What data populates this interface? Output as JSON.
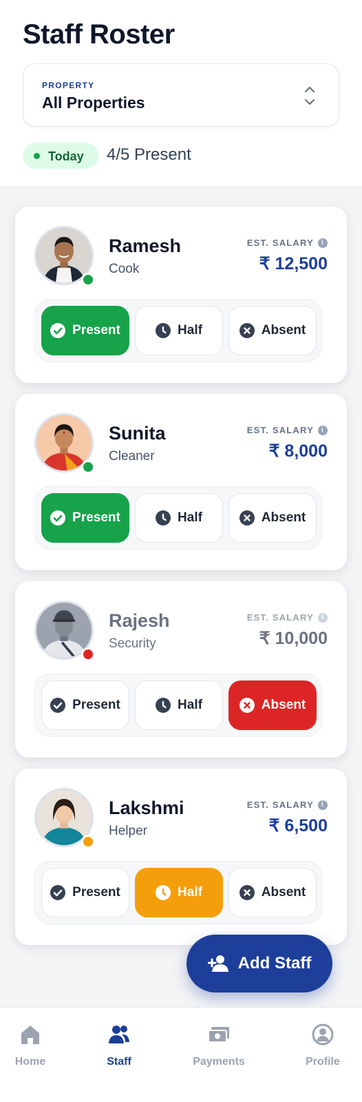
{
  "header": {
    "title": "Staff Roster",
    "property_label": "PROPERTY",
    "property_value": "All Properties",
    "today_label": "Today",
    "present_summary": "4/5 Present"
  },
  "staff": [
    {
      "name": "Ramesh",
      "role": "Cook",
      "salary_label": "EST. SALARY",
      "salary": "₹ 12,500",
      "status": "present",
      "status_color": "#16a34a",
      "options": {
        "present": "Present",
        "half": "Half",
        "absent": "Absent"
      }
    },
    {
      "name": "Sunita",
      "role": "Cleaner",
      "salary_label": "EST. SALARY",
      "salary": "₹ 8,000",
      "status": "present",
      "status_color": "#16a34a",
      "options": {
        "present": "Present",
        "half": "Half",
        "absent": "Absent"
      }
    },
    {
      "name": "Rajesh",
      "role": "Security",
      "salary_label": "EST. SALARY",
      "salary": "₹ 10,000",
      "status": "absent",
      "status_color": "#dc2626",
      "options": {
        "present": "Present",
        "half": "Half",
        "absent": "Absent"
      }
    },
    {
      "name": "Lakshmi",
      "role": "Helper",
      "salary_label": "EST. SALARY",
      "salary": "₹ 6,500",
      "status": "half",
      "status_color": "#f59e0b",
      "options": {
        "present": "Present",
        "half": "Half",
        "absent": "Absent"
      }
    }
  ],
  "fab": {
    "label": "Add Staff",
    "icon": "add-person-icon"
  },
  "nav": [
    {
      "label": "Home",
      "icon": "home-icon",
      "active": false
    },
    {
      "label": "Staff",
      "icon": "people-icon",
      "active": true
    },
    {
      "label": "Payments",
      "icon": "money-icon",
      "active": false
    },
    {
      "label": "Profile",
      "icon": "user-circle-icon",
      "active": false
    }
  ],
  "colors": {
    "brand": "#1d3f9a",
    "present": "#16a34a",
    "absent": "#dc2626",
    "half": "#f59e0b"
  }
}
